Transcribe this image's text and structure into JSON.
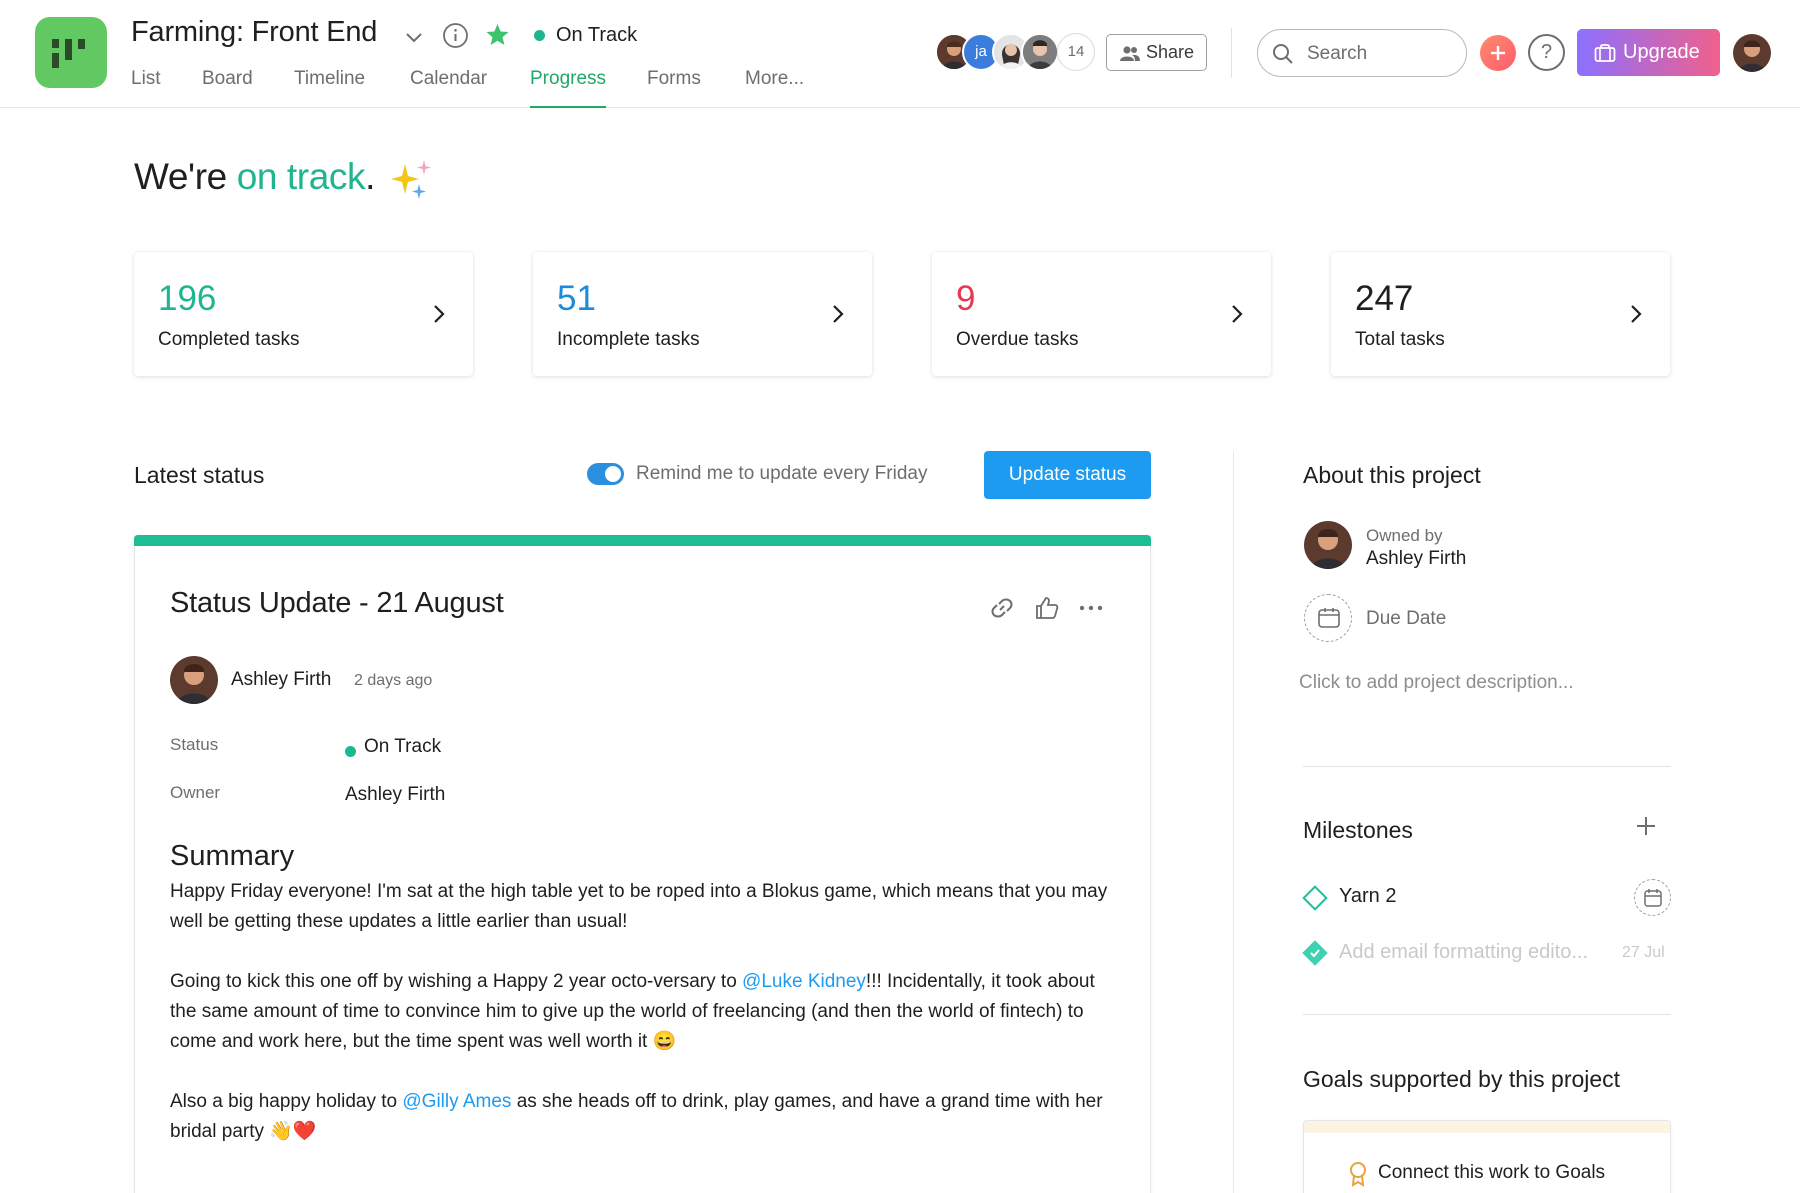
{
  "header": {
    "project_title": "Farming: Front End",
    "status_label": "On Track",
    "tabs": [
      {
        "label": "List"
      },
      {
        "label": "Board"
      },
      {
        "label": "Timeline"
      },
      {
        "label": "Calendar"
      },
      {
        "label": "Progress"
      },
      {
        "label": "Forms"
      },
      {
        "label": "More..."
      }
    ],
    "active_tab": "Progress",
    "member_initials": "ja",
    "member_count": "14",
    "share_label": "Share",
    "search_placeholder": "Search",
    "help_label": "?",
    "upgrade_label": "Upgrade"
  },
  "hero": {
    "prefix": "We're ",
    "accent": "on track",
    "suffix": "."
  },
  "stats": [
    {
      "value": "196",
      "label": "Completed tasks",
      "color": "#1fb58e"
    },
    {
      "value": "51",
      "label": "Incomplete tasks",
      "color": "#1d8bd7"
    },
    {
      "value": "9",
      "label": "Overdue tasks",
      "color": "#e8384f"
    },
    {
      "value": "247",
      "label": "Total tasks",
      "color": "#1e1f21"
    }
  ],
  "latest_status": {
    "title": "Latest status",
    "remind_label": "Remind me to update every Friday",
    "remind_enabled": true,
    "update_button": "Update status"
  },
  "status_update": {
    "title": "Status Update - 21 August",
    "author": "Ashley Firth",
    "time": "2 days ago",
    "fields": {
      "status_label": "Status",
      "status_value": "On Track",
      "owner_label": "Owner",
      "owner_value": "Ashley Firth"
    },
    "summary_heading": "Summary",
    "paragraphs": {
      "p1": "Happy Friday everyone! I'm sat at the high table yet to be roped into a Blokus game, which means that you may well be getting these updates a little earlier than usual!",
      "p2_before": "Going to kick this one off by wishing a Happy 2 year octo-versary to ",
      "p2_mention": "@Luke Kidney",
      "p2_after": "!!! Incidentally, it took about the same amount of time to convince him to give up the world of freelancing (and then the world of fintech) to come and work here, but the time spent was well worth it 😄",
      "p3_before": "Also a big happy holiday to ",
      "p3_mention": "@Gilly Ames",
      "p3_after": " as she heads off to drink, play games, and have a grand time with her bridal party 👋❤️"
    }
  },
  "about": {
    "title": "About this project",
    "owned_by_label": "Owned by",
    "owner_name": "Ashley Firth",
    "due_date_label": "Due Date",
    "description_placeholder": "Click to add project description..."
  },
  "milestones": {
    "title": "Milestones",
    "items": [
      {
        "name": "Yarn 2",
        "date": "",
        "done": false
      },
      {
        "name": "Add email formatting edito...",
        "date": "27 Jul",
        "done": true
      }
    ]
  },
  "goals": {
    "title": "Goals supported by this project",
    "connect_label": "Connect this work to Goals"
  },
  "colors": {
    "accent_green": "#1fb58e",
    "tab_active": "#1fa866",
    "primary_blue": "#1d9bf0",
    "logo_green": "#62c962"
  }
}
